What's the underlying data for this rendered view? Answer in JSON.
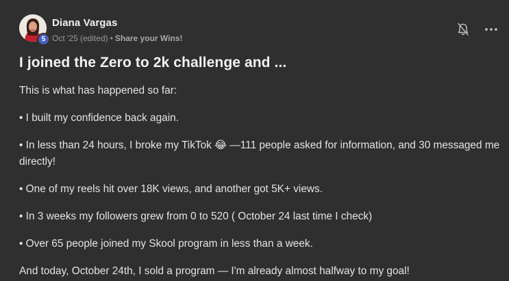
{
  "post": {
    "author": "Diana Vargas",
    "level": "5",
    "date": "Oct '25 (edited)",
    "separator": "•",
    "category": "Share your Wins!",
    "title": "I joined the Zero to 2k challenge and ...",
    "paragraphs": [
      "This is what has happened so far:",
      "• I built my confidence back again.",
      "• In less than 24 hours, I broke my TikTok 😂 —111 people asked for information, and 30 messaged me directly!",
      "• One of my reels hit over 18K views, and another got 5K+ views.",
      "• In 3 weeks my followers grew from 0 to 520 ( October 24 last time I check)",
      "• Over 65 people joined my Skool program in less than a week.",
      "And today, October 24th, I sold a program — I'm already almost halfway to my goal!"
    ]
  },
  "icons": {
    "notifications": "bell-off-icon",
    "more": "more-options-icon"
  },
  "colors": {
    "background": "#2f2f2f",
    "level_badge": "#4a5dbb",
    "text_primary": "#e4e4e4",
    "text_meta": "#9a9a9a"
  }
}
